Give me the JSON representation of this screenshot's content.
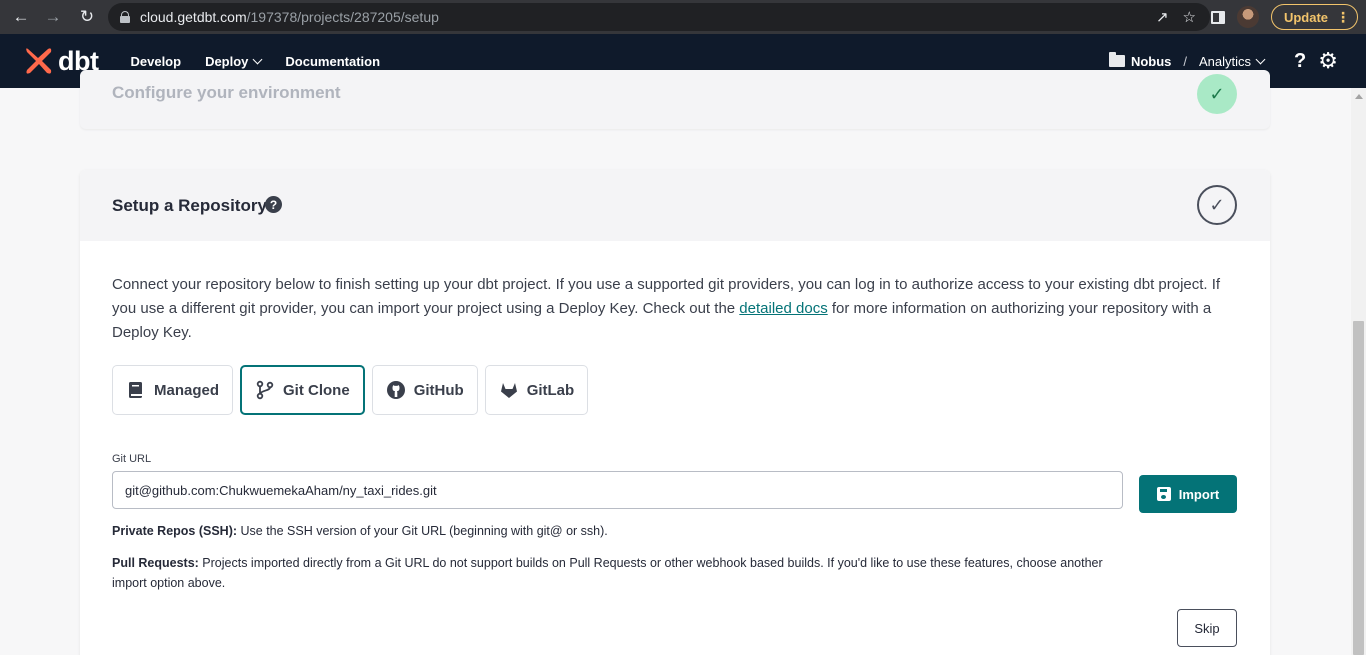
{
  "browser": {
    "url_host": "cloud.getdbt.com",
    "url_path": "/197378/projects/287205/setup",
    "update_label": "Update"
  },
  "header": {
    "logo_text": "dbt",
    "nav": [
      "Develop",
      "Deploy",
      "Documentation"
    ],
    "account": "Nobus",
    "separator": "/",
    "project": "Analytics",
    "help": "?"
  },
  "env_card": {
    "title": "Configure your environment"
  },
  "repo_card": {
    "title": "Setup a Repository",
    "description_before": "Connect your repository below to finish setting up your dbt project. If you use a supported git providers, you can log in to authorize access to your existing dbt project. If you use a different git provider, you can import your project using a Deploy Key. Check out the ",
    "description_link": "detailed docs",
    "description_after": " for more information on authorizing your repository with a Deploy Key.",
    "tabs": [
      "Managed",
      "Git Clone",
      "GitHub",
      "GitLab"
    ],
    "active_tab": "Git Clone",
    "git_url_label": "Git URL",
    "git_url_value": "git@github.com:ChukwuemekaAham/ny_taxi_rides.git",
    "import_label": "Import",
    "note1_bold": "Private Repos (SSH):",
    "note1_text": " Use the SSH version of your Git URL (beginning with git@ or ssh).",
    "note2_bold": "Pull Requests:",
    "note2_text": " Projects imported directly from a Git URL do not support builds on Pull Requests or other webhook based builds. If you'd like to use these features, choose another import option above.",
    "skip_label": "Skip"
  },
  "colors": {
    "brand": "#FF694B",
    "accent": "#047377",
    "header_bg": "#0F1A2B",
    "success_bg": "#A9E9C6"
  }
}
